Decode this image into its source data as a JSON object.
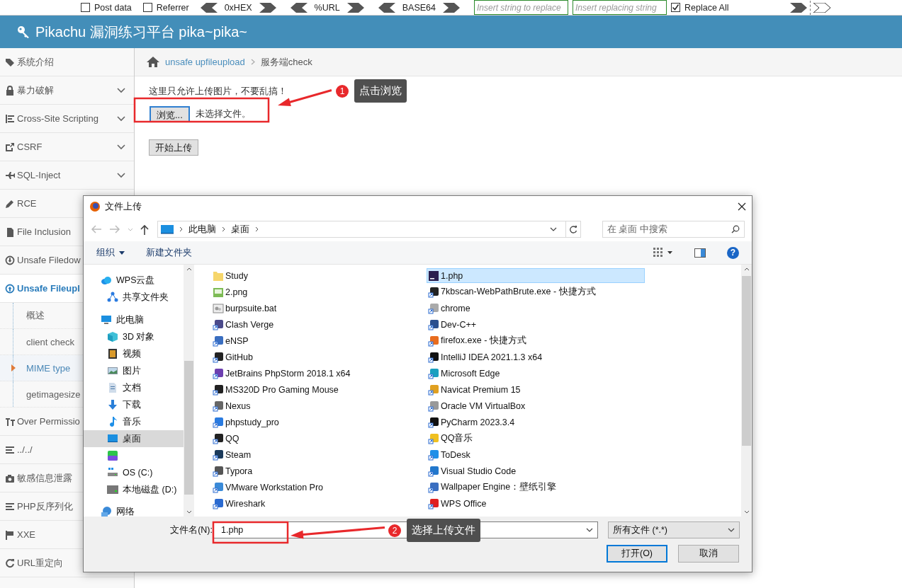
{
  "toolbar": [
    {
      "kind": "checkbox",
      "label": "Post data",
      "checked": false
    },
    {
      "kind": "checkbox",
      "label": "Referrer",
      "checked": false
    },
    {
      "kind": "encoder",
      "label": "0xHEX"
    },
    {
      "kind": "encoder",
      "label": "%URL"
    },
    {
      "kind": "encoder",
      "label": "BASE64"
    },
    {
      "kind": "field",
      "placeholder": "Insert string to replace"
    },
    {
      "kind": "field",
      "placeholder": "Insert replacing string"
    },
    {
      "kind": "checkbox",
      "label": "Replace All",
      "checked": true
    },
    {
      "kind": "arrows"
    }
  ],
  "header": {
    "title": "Pikachu 漏洞练习平台 pika~pika~"
  },
  "sidebar": {
    "items": [
      {
        "label": "系统介绍",
        "has_submenu": false,
        "selected": false
      },
      {
        "label": "暴力破解",
        "has_submenu": true,
        "selected": false
      },
      {
        "label": "Cross-Site Scripting",
        "has_submenu": true,
        "selected": false
      },
      {
        "label": "CSRF",
        "has_submenu": true,
        "selected": false
      },
      {
        "label": "SQL-Inject",
        "has_submenu": true,
        "selected": false
      },
      {
        "label": "RCE",
        "has_submenu": false,
        "selected": false
      },
      {
        "label": "File Inclusion",
        "has_submenu": false,
        "selected": false
      },
      {
        "label": "Unsafe Filedow",
        "has_submenu": false,
        "selected": false
      },
      {
        "label": "Unsafe Fileupl",
        "has_submenu": false,
        "selected": true,
        "children": [
          {
            "label": "概述",
            "selected": false
          },
          {
            "label": "client check",
            "selected": false
          },
          {
            "label": "MIME type",
            "selected": true
          },
          {
            "label": "getimagesize",
            "selected": false
          }
        ]
      },
      {
        "label": "Over Permissio",
        "has_submenu": false,
        "selected": false
      },
      {
        "label": "../../",
        "has_submenu": false,
        "selected": false
      },
      {
        "label": "敏感信息泄露",
        "has_submenu": false,
        "selected": false
      },
      {
        "label": "PHP反序列化",
        "has_submenu": false,
        "selected": false
      },
      {
        "label": "XXE",
        "has_submenu": false,
        "selected": false
      },
      {
        "label": "URL重定向",
        "has_submenu": false,
        "selected": false
      }
    ]
  },
  "breadcrumb": [
    {
      "label": "unsafe upfileupload",
      "kind": "link"
    },
    {
      "label": "服务端check",
      "kind": "current"
    }
  ],
  "upload_form": {
    "notice": "这里只允许上传图片，不要乱搞！",
    "browse_button": "浏览...",
    "file_status": "未选择文件。",
    "submit_button": "开始上传"
  },
  "dialog": {
    "title": "文件上传",
    "address": [
      "此电脑",
      "桌面"
    ],
    "search": {
      "placeholder": "在 桌面 中搜索"
    },
    "commands": [
      {
        "label": "组织",
        "kind": "menu"
      },
      {
        "label": "新建文件夹",
        "kind": "button"
      }
    ],
    "help_button": "?",
    "nav": [
      {
        "label": "WPS云盘",
        "selected": false,
        "children": [
          {
            "label": "共享文件夹",
            "selected": false
          }
        ]
      },
      {
        "label": "此电脑",
        "selected": false,
        "children": [
          {
            "label": "3D 对象",
            "selected": false
          },
          {
            "label": "视频",
            "selected": false
          },
          {
            "label": "图片",
            "selected": false
          },
          {
            "label": "文档",
            "selected": false
          },
          {
            "label": "下载",
            "selected": false
          },
          {
            "label": "音乐",
            "selected": false
          },
          {
            "label": "桌面",
            "selected": true
          },
          {
            "selected": false
          },
          {
            "label": "OS (C:)",
            "selected": false
          },
          {
            "label": "本地磁盘 (D:)",
            "selected": false
          }
        ]
      },
      {
        "label": "网络",
        "selected": false
      }
    ],
    "files": [
      {
        "name": "Study",
        "selected": false
      },
      {
        "name": "2.png",
        "selected": false
      },
      {
        "name": "burpsuite.bat",
        "selected": false
      },
      {
        "name": "Clash Verge",
        "selected": false
      },
      {
        "name": "eNSP",
        "selected": false
      },
      {
        "name": "GitHub",
        "selected": false
      },
      {
        "name": "JetBrains PhpStorm 2018.1 x64",
        "selected": false
      },
      {
        "name": "MS320D Pro Gaming Mouse",
        "selected": false
      },
      {
        "name": "Nexus",
        "selected": false
      },
      {
        "name": "phpstudy_pro",
        "selected": false
      },
      {
        "name": "QQ",
        "selected": false
      },
      {
        "name": "Steam",
        "selected": false
      },
      {
        "name": "Typora",
        "selected": false
      },
      {
        "name": "VMware Workstation Pro",
        "selected": false
      },
      {
        "name": "Wireshark",
        "selected": false
      },
      {
        "name": "1.php",
        "selected": true
      },
      {
        "name": "7kbscan-WebPathBrute.exe - 快捷方式",
        "selected": false
      },
      {
        "name": "chrome",
        "selected": false
      },
      {
        "name": "Dev-C++",
        "selected": false
      },
      {
        "name": "firefox.exe - 快捷方式",
        "selected": false
      },
      {
        "name": "IntelliJ IDEA 2021.1.3 x64",
        "selected": false
      },
      {
        "name": "Microsoft Edge",
        "selected": false
      },
      {
        "name": "Navicat Premium 15",
        "selected": false
      },
      {
        "name": "Oracle VM VirtualBox",
        "selected": false
      },
      {
        "name": "PyCharm 2023.3.4",
        "selected": false
      },
      {
        "name": "QQ音乐",
        "selected": false
      },
      {
        "name": "ToDesk",
        "selected": false
      },
      {
        "name": "Visual Studio Code",
        "selected": false
      },
      {
        "name": "Wallpaper Engine：壁纸引擎",
        "selected": false
      },
      {
        "name": "WPS Office",
        "selected": false
      }
    ],
    "filename_label": "文件名(N):",
    "filename": "1.php",
    "filter": "所有文件 (*.*)",
    "buttons": [
      {
        "label": "打开(O)",
        "kind": "default"
      },
      {
        "label": "取消",
        "kind": "normal"
      }
    ]
  },
  "annotations": [
    {
      "number": "1",
      "text": "点击浏览"
    },
    {
      "number": "2",
      "text": "选择上传文件"
    }
  ]
}
